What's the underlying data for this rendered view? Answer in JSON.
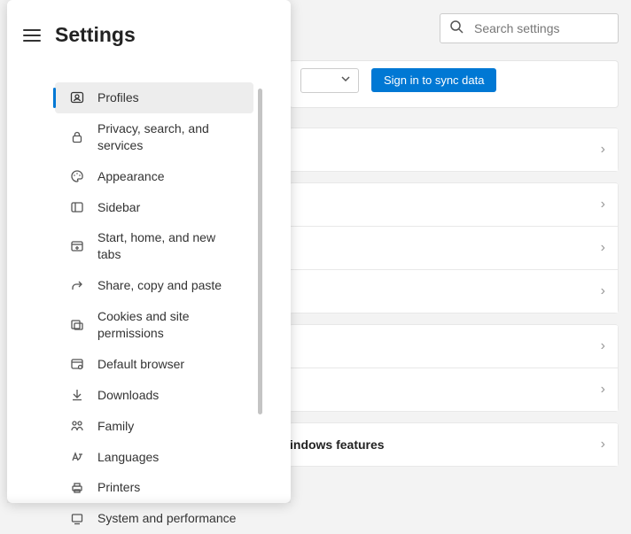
{
  "header": {
    "title": "Settings",
    "search_placeholder": "Search settings"
  },
  "sidebar": {
    "items": [
      {
        "label": "Profiles",
        "active": true
      },
      {
        "label": "Privacy, search, and services"
      },
      {
        "label": "Appearance"
      },
      {
        "label": "Sidebar"
      },
      {
        "label": "Start, home, and new tabs"
      },
      {
        "label": "Share, copy and paste"
      },
      {
        "label": "Cookies and site permissions"
      },
      {
        "label": "Default browser"
      },
      {
        "label": "Downloads"
      },
      {
        "label": "Family"
      },
      {
        "label": "Languages"
      },
      {
        "label": "Printers"
      },
      {
        "label": "System and performance"
      }
    ]
  },
  "content": {
    "signin_button": "Sign in to sync data",
    "rows": [
      {
        "label": ""
      },
      {
        "label": ""
      },
      {
        "label": ""
      },
      {
        "label": ""
      },
      {
        "label": ""
      },
      {
        "label": ""
      },
      {
        "label": "indows features"
      }
    ]
  }
}
